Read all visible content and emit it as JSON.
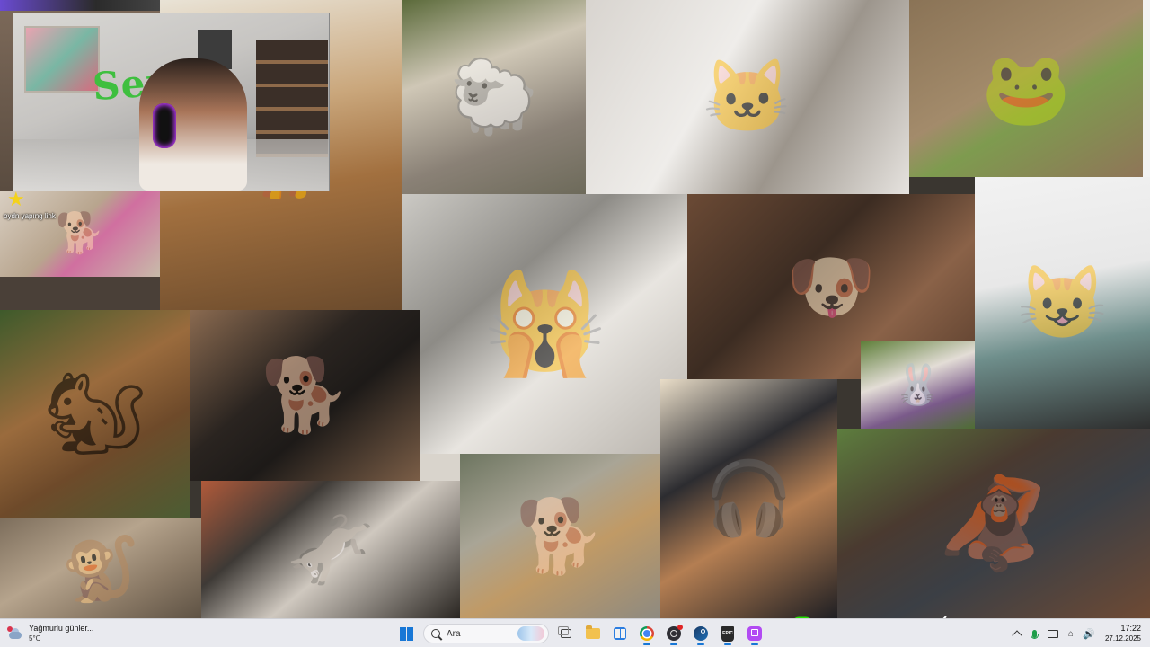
{
  "stream_overlay": {
    "alert_caption": "oydn yapıng link",
    "badge_icon": "star-icon",
    "social_icons": [
      "instagram-icon",
      "tiktok-icon",
      "kick-icon",
      "youtube-icon",
      "sparkle-icon"
    ],
    "neon_color": "#22e000"
  },
  "collage": {
    "tiles": [
      {
        "id": "sheep",
        "icon": "sheep-photo"
      },
      {
        "id": "cat-on-toilet",
        "icon": "cat-phone-photo"
      },
      {
        "id": "frog",
        "icon": "frog-photo"
      },
      {
        "id": "fluffy-cat",
        "icon": "cat-photo"
      },
      {
        "id": "shocked-cat",
        "icon": "cat-photo"
      },
      {
        "id": "dog-vs-cat",
        "icon": "dog-cat-photo"
      },
      {
        "id": "cat-in-dress",
        "icon": "cat-photo"
      },
      {
        "id": "squirrel",
        "icon": "squirrel-photo"
      },
      {
        "id": "black-dog",
        "icon": "dog-photo"
      },
      {
        "id": "bunny-bulldog",
        "icon": "bulldog-photo"
      },
      {
        "id": "gamer-cat",
        "icon": "cat-gamer-photo"
      },
      {
        "id": "orangutan",
        "icon": "orangutan-photo"
      },
      {
        "id": "dogs",
        "icon": "dog-photo"
      },
      {
        "id": "donkey",
        "icon": "donkey-photo"
      },
      {
        "id": "monkey",
        "icon": "monkey-photo"
      }
    ]
  },
  "webcam": {
    "wall_sign": "Senko"
  },
  "taskbar": {
    "weather": {
      "condition": "Yağmurlu günler...",
      "temperature": "5°C",
      "icon": "rain-cloud-icon"
    },
    "search_placeholder": "Ara",
    "apps": [
      {
        "name": "start-button",
        "icon": "windows-logo-icon"
      },
      {
        "name": "task-view",
        "icon": "task-view-icon"
      },
      {
        "name": "file-explorer",
        "icon": "folder-icon"
      },
      {
        "name": "microsoft-store",
        "icon": "store-icon"
      },
      {
        "name": "chrome",
        "icon": "chrome-icon"
      },
      {
        "name": "obs",
        "icon": "obs-icon"
      },
      {
        "name": "steam",
        "icon": "steam-icon"
      },
      {
        "name": "epic-games",
        "icon": "epic-icon",
        "label": "EPIC"
      },
      {
        "name": "twitch",
        "icon": "twitch-icon"
      }
    ],
    "tray": {
      "time": "17:22",
      "date": "27.12.2025"
    },
    "accent": "#1877d6"
  }
}
